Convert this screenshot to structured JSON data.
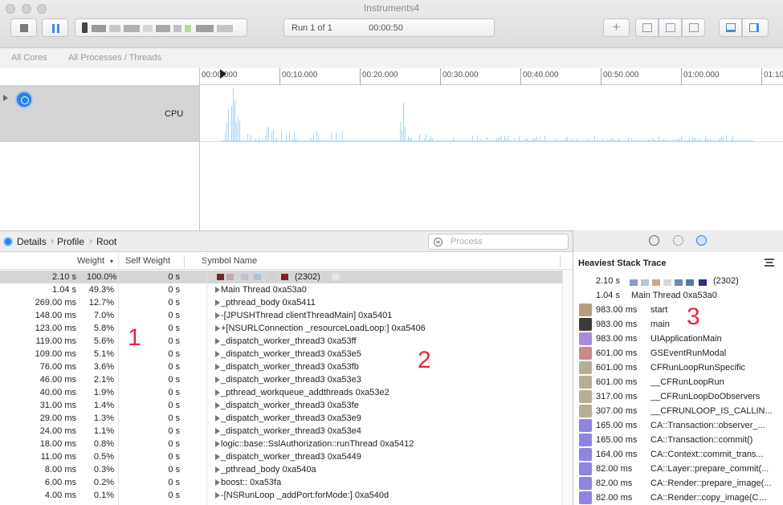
{
  "window": {
    "title": "Instruments4"
  },
  "toolbar": {
    "run_label": "Run 1 of 1",
    "run_time": "00:00:50"
  },
  "filter_bar": {
    "cores": "All Cores",
    "processes": "All Processes / Threads"
  },
  "timeline": {
    "ticks": [
      "00:00.000",
      "00:10.000",
      "00:20.000",
      "00:30.000",
      "00:40.000",
      "00:50.000",
      "01:00.000",
      "01:10"
    ]
  },
  "track": {
    "label": "CPU",
    "bar_color": "#a6d8f7"
  },
  "details_bar": {
    "crumbs": [
      "Details",
      "Profile",
      "Root"
    ],
    "process_placeholder": "Process"
  },
  "table": {
    "columns": {
      "weight": "Weight",
      "self_weight": "Self Weight",
      "symbol_name": "Symbol Name"
    },
    "rows": [
      {
        "weight": "2.10 s",
        "percent": "100.0%",
        "self": "0 s",
        "symbol": "(2302)"
      },
      {
        "weight": "1.04 s",
        "percent": "49.3%",
        "self": "0 s",
        "symbol": "Main Thread  0xa53a0"
      },
      {
        "weight": "269.00 ms",
        "percent": "12.7%",
        "self": "0 s",
        "symbol": "_pthread_body  0xa5411"
      },
      {
        "weight": "148.00 ms",
        "percent": "7.0%",
        "self": "0 s",
        "symbol": "-[JPUSHThread clientThreadMain]  0xa5401"
      },
      {
        "weight": "123.00 ms",
        "percent": "5.8%",
        "self": "0 s",
        "symbol": "+[NSURLConnection _resourceLoadLoop:]  0xa5406"
      },
      {
        "weight": "119.00 ms",
        "percent": "5.6%",
        "self": "0 s",
        "symbol": "_dispatch_worker_thread3  0xa53ff"
      },
      {
        "weight": "109.00 ms",
        "percent": "5.1%",
        "self": "0 s",
        "symbol": "_dispatch_worker_thread3  0xa53e5"
      },
      {
        "weight": "76.00 ms",
        "percent": "3.6%",
        "self": "0 s",
        "symbol": "_dispatch_worker_thread3  0xa53fb"
      },
      {
        "weight": "46.00 ms",
        "percent": "2.1%",
        "self": "0 s",
        "symbol": "_dispatch_worker_thread3  0xa53e3"
      },
      {
        "weight": "40.00 ms",
        "percent": "1.9%",
        "self": "0 s",
        "symbol": "_pthread_workqueue_addthreads  0xa53e2"
      },
      {
        "weight": "31.00 ms",
        "percent": "1.4%",
        "self": "0 s",
        "symbol": "_dispatch_worker_thread3  0xa53fe"
      },
      {
        "weight": "29.00 ms",
        "percent": "1.3%",
        "self": "0 s",
        "symbol": "_dispatch_worker_thread3  0xa53e9"
      },
      {
        "weight": "24.00 ms",
        "percent": "1.1%",
        "self": "0 s",
        "symbol": "_dispatch_worker_thread3  0xa53e4"
      },
      {
        "weight": "18.00 ms",
        "percent": "0.8%",
        "self": "0 s",
        "symbol": "logic::base::SslAuthorization::runThread  0xa5412"
      },
      {
        "weight": "11.00 ms",
        "percent": "0.5%",
        "self": "0 s",
        "symbol": "_dispatch_worker_thread3  0xa5449"
      },
      {
        "weight": "8.00 ms",
        "percent": "0.3%",
        "self": "0 s",
        "symbol": "_pthread_body  0xa540a"
      },
      {
        "weight": "6.00 ms",
        "percent": "0.2%",
        "self": "0 s",
        "symbol": "boost::  0xa53fa"
      },
      {
        "weight": "4.00 ms",
        "percent": "0.1%",
        "self": "0 s",
        "symbol": "-[NSRunLoop _addPort:forMode:]  0xa540d"
      }
    ]
  },
  "stack_trace": {
    "title": "Heaviest Stack Trace",
    "summary": [
      {
        "time": "2.10 s",
        "label": "(2302)"
      },
      {
        "time": "1.04 s",
        "label": "Main Thread  0xa53a0"
      }
    ],
    "frames": [
      {
        "time": "983.00 ms",
        "symbol": "start",
        "icon_color": "#b5a07a"
      },
      {
        "time": "983.00 ms",
        "symbol": "main",
        "icon_color": "#3a3a3a"
      },
      {
        "time": "983.00 ms",
        "symbol": "UIApplicationMain",
        "icon_color": "#a98bd9"
      },
      {
        "time": "601.00 ms",
        "symbol": "GSEventRunModal",
        "icon_color": "#c98a8a"
      },
      {
        "time": "601.00 ms",
        "symbol": "CFRunLoopRunSpecific",
        "icon_color": "#b8ad96"
      },
      {
        "time": "601.00 ms",
        "symbol": "__CFRunLoopRun",
        "icon_color": "#b8ad96"
      },
      {
        "time": "317.00 ms",
        "symbol": "__CFRunLoopDoObservers",
        "icon_color": "#b8ad96"
      },
      {
        "time": "307.00 ms",
        "symbol": "__CFRUNLOOP_IS_CALLIN...",
        "icon_color": "#b8ad96"
      },
      {
        "time": "165.00 ms",
        "symbol": "CA::Transaction::observer_...",
        "icon_color": "#8f84e0"
      },
      {
        "time": "165.00 ms",
        "symbol": "CA::Transaction::commit()",
        "icon_color": "#8f84e0"
      },
      {
        "time": "164.00 ms",
        "symbol": "CA::Context::commit_trans...",
        "icon_color": "#8f84e0"
      },
      {
        "time": "82.00 ms",
        "symbol": "CA::Layer::prepare_commit(...",
        "icon_color": "#8f84e0"
      },
      {
        "time": "82.00 ms",
        "symbol": "CA::Render::prepare_image(...",
        "icon_color": "#8f84e0"
      },
      {
        "time": "82.00 ms",
        "symbol": "CA::Render::copy_image(CG...",
        "icon_color": "#8f84e0"
      }
    ]
  },
  "annotations": [
    "1",
    "2",
    "3"
  ],
  "colors": {
    "accent": "#2a82e4",
    "annotation": "#e8263d",
    "selected_row": "#d5d5d5"
  }
}
